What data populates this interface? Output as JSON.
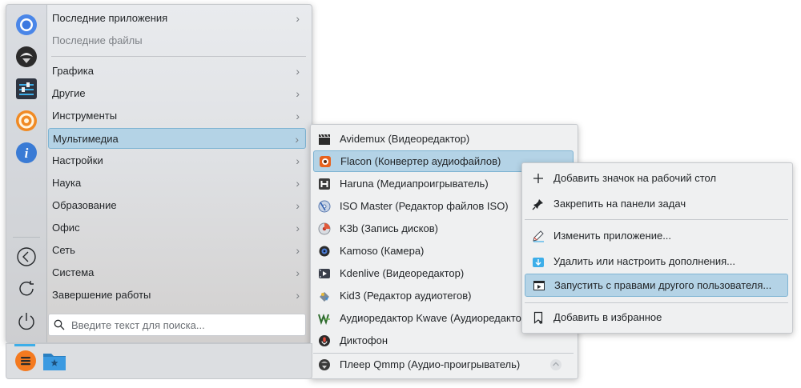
{
  "categories": [
    {
      "label": "Последние приложения",
      "muted": false
    },
    {
      "label": "Последние файлы",
      "muted": true
    },
    {
      "label": "Графика",
      "muted": false
    },
    {
      "label": "Другие",
      "muted": false
    },
    {
      "label": "Инструменты",
      "muted": false
    },
    {
      "label": "Мультимедиа",
      "muted": false,
      "active": true
    },
    {
      "label": "Настройки",
      "muted": false
    },
    {
      "label": "Наука",
      "muted": false
    },
    {
      "label": "Образование",
      "muted": false
    },
    {
      "label": "Офис",
      "muted": false
    },
    {
      "label": "Сеть",
      "muted": false
    },
    {
      "label": "Система",
      "muted": false
    },
    {
      "label": "Завершение работы",
      "muted": false
    }
  ],
  "search": {
    "placeholder": "Введите текст для поиска..."
  },
  "multimedia": [
    {
      "label": "Avidemux (Видеоредактор)",
      "icon": "clapperboard-icon"
    },
    {
      "label": "Flacon (Конвертер аудиофайлов)",
      "icon": "flacon-icon",
      "active": true
    },
    {
      "label": "Haruna (Медиапроигрыватель)",
      "icon": "haruna-icon"
    },
    {
      "label": "ISO Master (Редактор файлов ISO)",
      "icon": "disc-icon"
    },
    {
      "label": "K3b (Запись дисков)",
      "icon": "k3b-icon"
    },
    {
      "label": "Kamoso (Камера)",
      "icon": "camera-icon"
    },
    {
      "label": "Kdenlive (Видеоредактор)",
      "icon": "kdenlive-icon"
    },
    {
      "label": "Kid3 (Редактор аудиотегов)",
      "icon": "kid3-icon"
    },
    {
      "label": "Аудиоредактор Kwave (Аудиоредактор)",
      "icon": "kwave-icon"
    },
    {
      "label": "Диктофон",
      "icon": "microphone-icon"
    },
    {
      "label": "Плеер Qmmp (Аудио-проигрыватель)",
      "icon": "qmmp-icon"
    }
  ],
  "context_menu": [
    {
      "label": "Добавить значок на рабочий стол",
      "icon": "plus-icon"
    },
    {
      "label": "Закрепить на панели задач",
      "icon": "pin-icon"
    },
    {
      "label": "Изменить приложение...",
      "icon": "edit-app-icon"
    },
    {
      "label": "Удалить или настроить дополнения...",
      "icon": "addons-icon"
    },
    {
      "label": "Запустить с правами другого пользователя...",
      "icon": "run-as-icon",
      "active": true
    },
    {
      "label": "Добавить в избранное",
      "icon": "bookmark-icon"
    }
  ],
  "colors": {
    "accent": "#3daee9",
    "highlight": "#b4d3e6",
    "highlight_border": "#7fb4d3"
  }
}
